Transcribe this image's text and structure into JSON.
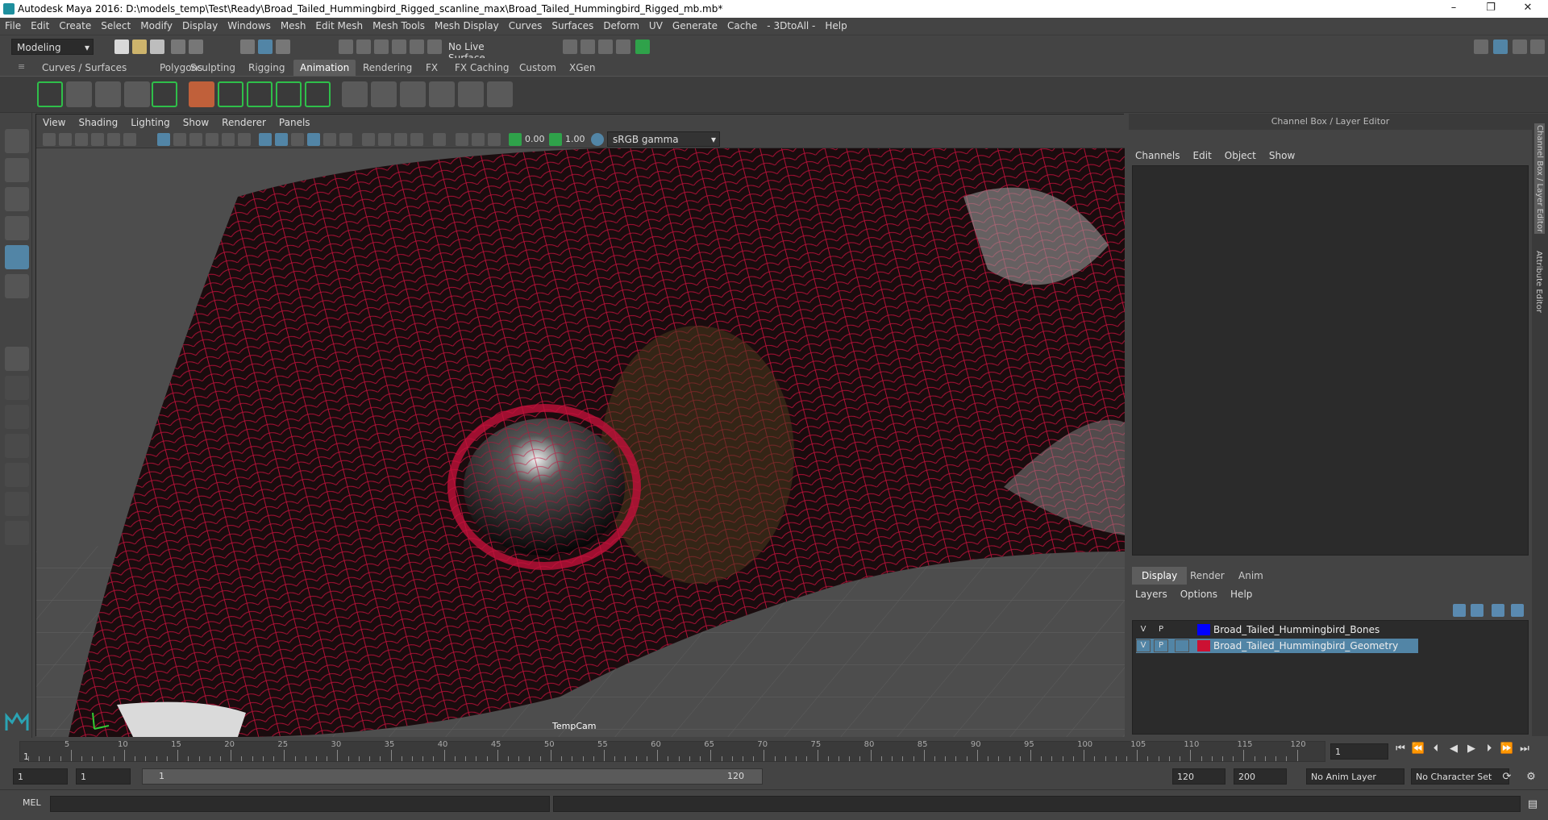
{
  "window": {
    "title": "Autodesk Maya 2016: D:\\models_temp\\Test\\Ready\\Broad_Tailed_Hummingbird_Rigged_scanline_max\\Broad_Tailed_Hummingbird_Rigged_mb.mb*",
    "minimize": "–",
    "maximize": "❐",
    "close": "✕"
  },
  "menubar": [
    "File",
    "Edit",
    "Create",
    "Select",
    "Modify",
    "Display",
    "Windows",
    "Mesh",
    "Edit Mesh",
    "Mesh Tools",
    "Mesh Display",
    "Curves",
    "Surfaces",
    "Deform",
    "UV",
    "Generate",
    "Cache",
    "- 3DtoAll -",
    "Help"
  ],
  "statusline": {
    "mode": "Modeling",
    "live_surface": "No Live Surface"
  },
  "shelf_tabs": [
    {
      "label": "Curves / Surfaces",
      "active": false
    },
    {
      "label": "Polygons",
      "active": false
    },
    {
      "label": "Sculpting",
      "active": false
    },
    {
      "label": "Rigging",
      "active": false
    },
    {
      "label": "Animation",
      "active": true
    },
    {
      "label": "Rendering",
      "active": false
    },
    {
      "label": "FX",
      "active": false
    },
    {
      "label": "FX Caching",
      "active": false
    },
    {
      "label": "Custom",
      "active": false
    },
    {
      "label": "XGen",
      "active": false
    }
  ],
  "viewport": {
    "menu": [
      "View",
      "Shading",
      "Lighting",
      "Show",
      "Renderer",
      "Panels"
    ],
    "exposure": "0.00",
    "gamma": "1.00",
    "color_space": "sRGB gamma",
    "camera": "TempCam"
  },
  "channel_box": {
    "title": "Channel Box / Layer Editor",
    "menu": [
      "Channels",
      "Edit",
      "Object",
      "Show"
    ],
    "side_tabs": [
      "Channel Box / Layer Editor",
      "Attribute Editor"
    ]
  },
  "layer_editor": {
    "tabs": [
      {
        "label": "Display",
        "active": true
      },
      {
        "label": "Render",
        "active": false
      },
      {
        "label": "Anim",
        "active": false
      }
    ],
    "menu": [
      "Layers",
      "Options",
      "Help"
    ],
    "layers": [
      {
        "v": "V",
        "p": "P",
        "color": "#0000ff",
        "name": "Broad_Tailed_Hummingbird_Bones",
        "selected": false
      },
      {
        "v": "V",
        "p": "P",
        "color": "#cc1133",
        "name": "Broad_Tailed_Hummingbird_Geometry",
        "selected": true
      }
    ]
  },
  "timeline": {
    "labels": [
      "5",
      "10",
      "15",
      "20",
      "25",
      "30",
      "35",
      "40",
      "45",
      "50",
      "55",
      "60",
      "65",
      "70",
      "75",
      "80",
      "85",
      "90",
      "95",
      "100",
      "105",
      "110",
      "115",
      "120"
    ],
    "start_marker": "1",
    "current_frame": "1"
  },
  "range": {
    "start": "1",
    "playback_start": "1",
    "slider_start": "1",
    "slider_end": "120",
    "playback_end": "120",
    "end": "200",
    "anim_layer": "No Anim Layer",
    "character_set": "No Character Set"
  },
  "command": {
    "language": "MEL"
  },
  "colors": {
    "wireframe": "#c0103a",
    "accent": "#5285a6",
    "maya_teal": "#1e8f9e"
  }
}
